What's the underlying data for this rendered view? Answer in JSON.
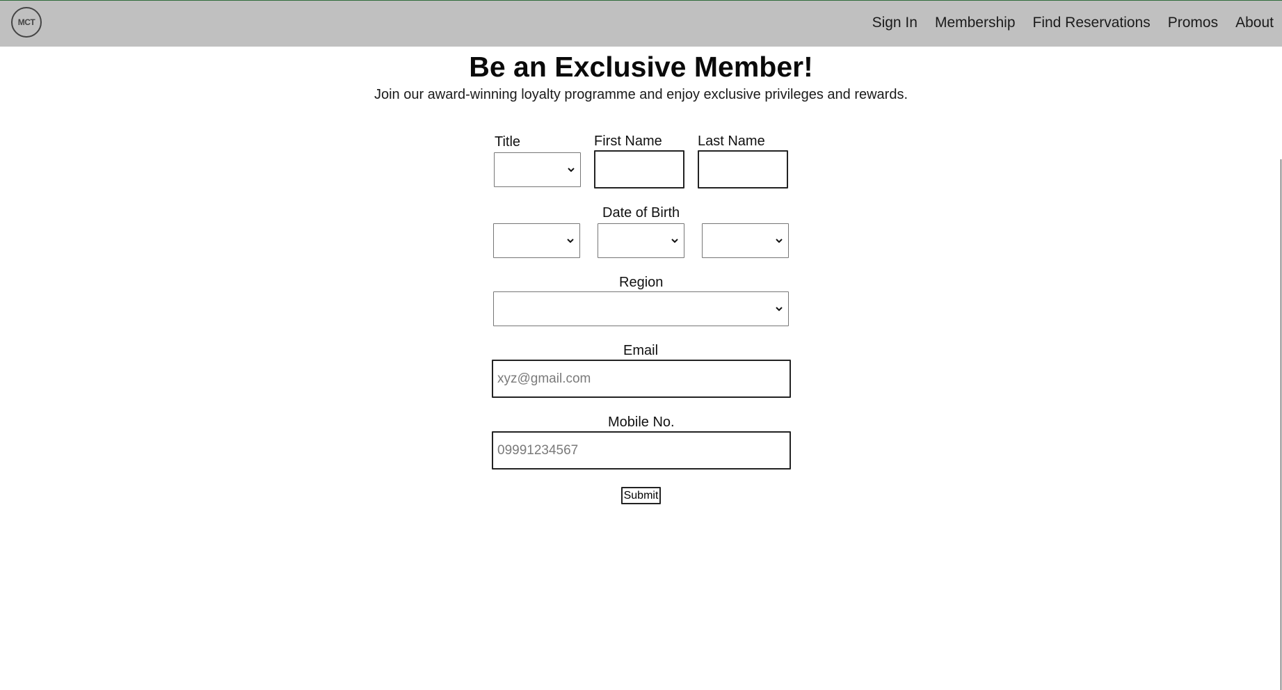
{
  "logo": {
    "text": "MCT"
  },
  "nav": {
    "items": [
      "Sign In",
      "Membership",
      "Find Reservations",
      "Promos",
      "About"
    ]
  },
  "hero": {
    "title": "Be an Exclusive Member!",
    "subtitle": "Join our award-winning loyalty programme and enjoy exclusive privileges and rewards."
  },
  "form": {
    "title_label": "Title",
    "first_name_label": "First Name",
    "last_name_label": "Last Name",
    "dob_label": "Date of Birth",
    "region_label": "Region",
    "email_label": "Email",
    "email_placeholder": "xyz@gmail.com",
    "mobile_label": "Mobile No.",
    "mobile_placeholder": "09991234567",
    "submit_label": "Submit"
  },
  "icons": {
    "dropdown": "chevron-down-icon"
  }
}
